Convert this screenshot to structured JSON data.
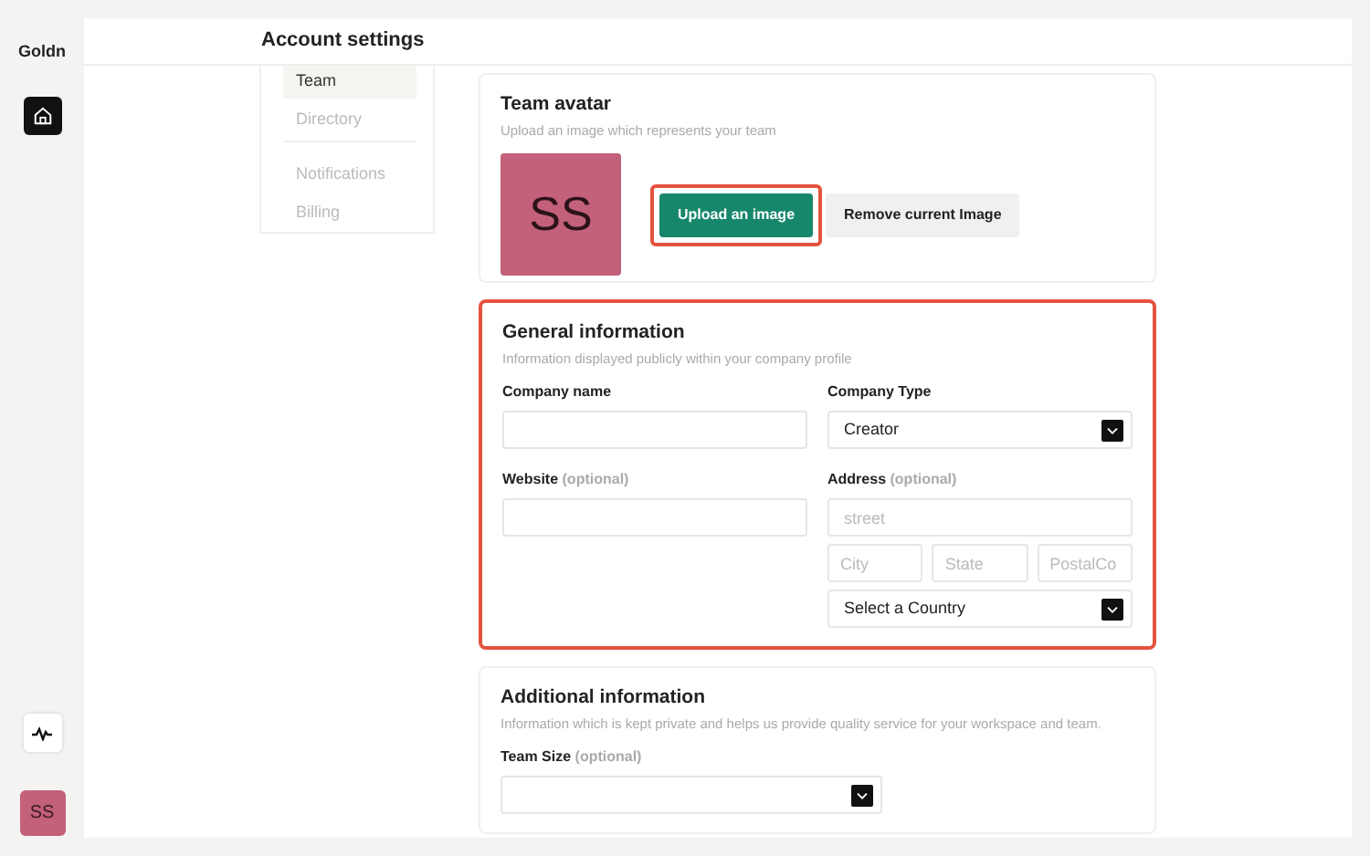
{
  "app": {
    "logo": "Goldn"
  },
  "rail": [
    {
      "kind": "home",
      "selected": true
    },
    {
      "kind": "activity",
      "selected": false
    }
  ],
  "user": {
    "initials": "SS"
  },
  "header": {
    "title": "Account settings"
  },
  "settings_nav": {
    "groups": [
      [
        {
          "label": "Team",
          "selected": true
        },
        {
          "label": "Directory",
          "selected": false
        }
      ],
      [
        {
          "label": "Notifications",
          "selected": false
        },
        {
          "label": "Billing",
          "selected": false
        }
      ]
    ]
  },
  "sections": [
    {
      "kind": "avatar",
      "title": "Team avatar",
      "subtitle": "Upload an image which represents your team",
      "highlighted": false,
      "avatar": {
        "initials": "SS"
      },
      "buttons": [
        {
          "label": "Upload an image",
          "kind": "primary",
          "highlighted": true
        },
        {
          "label": "Remove current Image",
          "kind": "secondary",
          "highlighted": false
        }
      ]
    },
    {
      "kind": "form",
      "title": "General information",
      "subtitle": "Information displayed publicly within your company profile",
      "highlighted": true,
      "columns": [
        [
          {
            "kind": "text",
            "label": "Company name"
          },
          {
            "kind": "text",
            "label": "Website",
            "note": "(optional)"
          }
        ],
        [
          {
            "kind": "select",
            "label": "Company Type",
            "value": "Creator"
          },
          {
            "kind": "address",
            "label": "Address",
            "note": "(optional)",
            "street": {
              "placeholder": "street"
            },
            "city": {
              "placeholder": "City"
            },
            "state": {
              "placeholder": "State"
            },
            "postal": {
              "placeholder": "PostalCo"
            },
            "country": {
              "value": "Select a Country"
            }
          }
        ]
      ]
    },
    {
      "kind": "form",
      "title": "Additional information",
      "subtitle": "Information which is kept private and helps us provide quality service for your workspace and team.",
      "highlighted": false,
      "columns": [
        [
          {
            "kind": "select",
            "label": "Team Size",
            "note": "(optional)"
          }
        ]
      ]
    }
  ]
}
